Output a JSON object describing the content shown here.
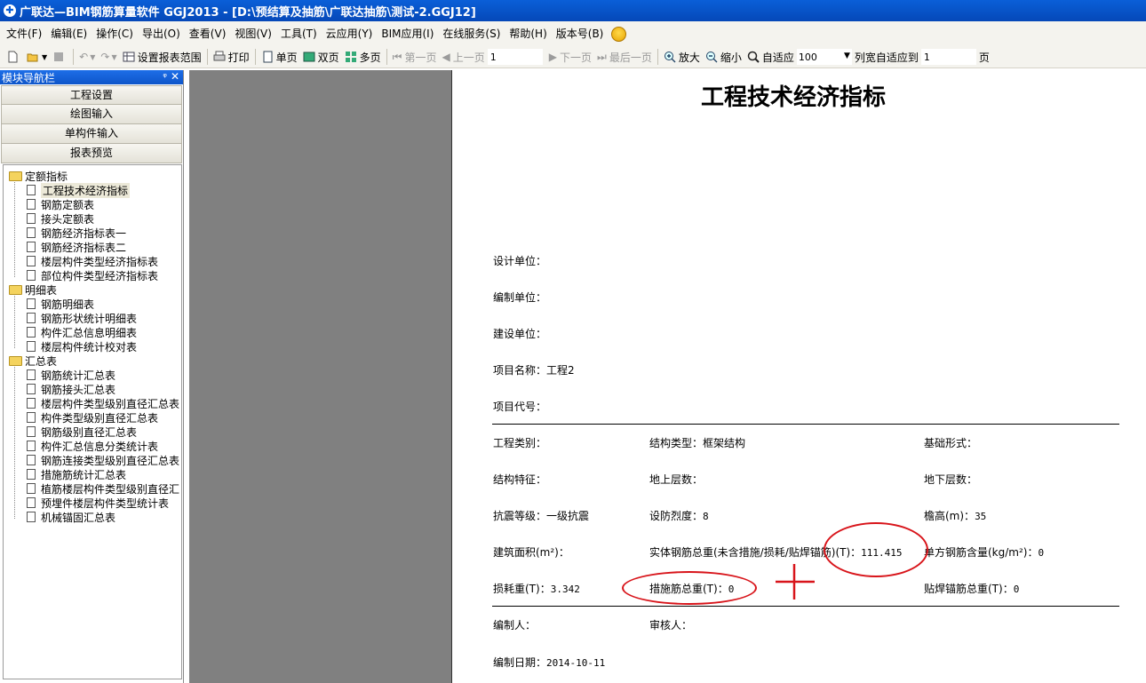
{
  "window": {
    "title": "广联达—BIM钢筋算量软件 GGJ2013 - [D:\\预结算及抽筋\\广联达抽筋\\测试-2.GGJ12]"
  },
  "menu": [
    "文件(F)",
    "编辑(E)",
    "操作(C)",
    "导出(O)",
    "查看(V)",
    "视图(V)",
    "工具(T)",
    "云应用(Y)",
    "BIM应用(I)",
    "在线服务(S)",
    "帮助(H)",
    "版本号(B)"
  ],
  "toolbar": {
    "set_range": "设置报表范围",
    "print": "打印",
    "single_page": "单页",
    "double_page": "双页",
    "multi_page": "多页",
    "first_page": "第一页",
    "prev_page": "上一页",
    "page_value": "1",
    "next_page": "下一页",
    "last_page": "最后一页",
    "zoom_in": "放大",
    "zoom_out": "缩小",
    "fit": "自适应",
    "zoom_value": "100",
    "col_fit": "列宽自适应到",
    "col_value": "1",
    "page_unit": "页"
  },
  "sidebar": {
    "header": "模块导航栏",
    "nav_buttons": [
      "工程设置",
      "绘图输入",
      "单构件输入",
      "报表预览"
    ],
    "groups": [
      {
        "label": "定额指标",
        "items": [
          "工程技术经济指标",
          "钢筋定额表",
          "接头定额表",
          "钢筋经济指标表一",
          "钢筋经济指标表二",
          "楼层构件类型经济指标表",
          "部位构件类型经济指标表"
        ]
      },
      {
        "label": "明细表",
        "items": [
          "钢筋明细表",
          "钢筋形状统计明细表",
          "构件汇总信息明细表",
          "楼层构件统计校对表"
        ]
      },
      {
        "label": "汇总表",
        "items": [
          "钢筋统计汇总表",
          "钢筋接头汇总表",
          "楼层构件类型级别直径汇总表",
          "构件类型级别直径汇总表",
          "钢筋级别直径汇总表",
          "构件汇总信息分类统计表",
          "钢筋连接类型级别直径汇总表",
          "措施筋统计汇总表",
          "植筋楼层构件类型级别直径汇",
          "预埋件楼层构件类型统计表",
          "机械锚固汇总表"
        ]
      }
    ]
  },
  "report": {
    "title": "工程技术经济指标",
    "design_unit": "设计单位：",
    "compile_unit": "编制单位：",
    "build_unit": "建设单位：",
    "project_name_label": "项目名称：",
    "project_name": "工程2",
    "project_code": "项目代号：",
    "project_type": "工程类别：",
    "structure_type_label": "结构类型：",
    "structure_type": "框架结构",
    "foundation": "基础形式：",
    "structure_feature": "结构特征：",
    "above_floors": "地上层数：",
    "under_floors": "地下层数：",
    "seismic_label": "抗震等级：",
    "seismic": "一级抗震",
    "intensity_label": "设防烈度：",
    "intensity": "8",
    "eave_label": "檐高(m)：",
    "eave": "35",
    "area": "建筑面积(m²)：",
    "rebar_total_label": "实体钢筋总重(未含措施/损耗/贴焊锚筋)(T)：",
    "rebar_total": "111.415",
    "unit_content_label": "单方钢筋含量(kg/m²)：",
    "unit_content": "0",
    "loss_label": "损耗重(T)：",
    "loss": "3.342",
    "measure_label": "措施筋总重(T)：",
    "measure": "0",
    "weld_label": "贴焊锚筋总重(T)：",
    "weld": "0",
    "compiler": "编制人：",
    "reviewer": "审核人：",
    "date_label": "编制日期：",
    "date": "2014-10-11"
  },
  "colors": {
    "title_bar": "#0a5fd8",
    "annotation": "#d8141a",
    "gray_area": "#808080"
  }
}
